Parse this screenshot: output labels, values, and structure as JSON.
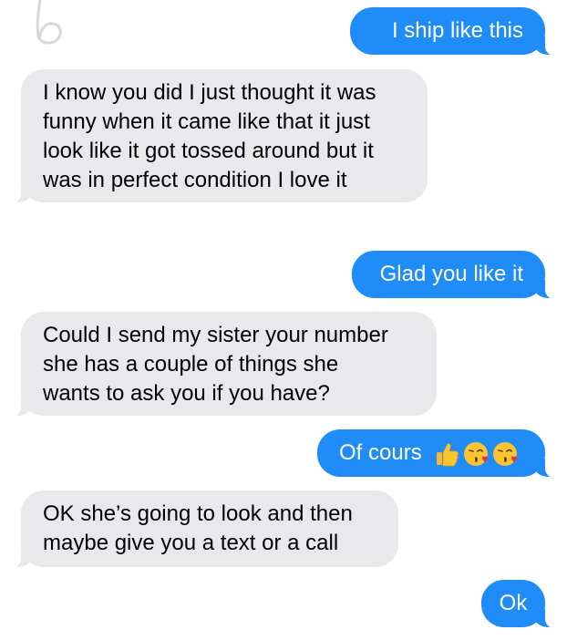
{
  "messages": [
    {
      "id": "m1",
      "direction": "sent",
      "text": "I ship like this"
    },
    {
      "id": "m2",
      "direction": "received",
      "lines": [
        "I know you did I just thought it was",
        "funny when it came like that it just",
        "look like it got tossed around but it",
        "was in perfect condition I love it"
      ]
    },
    {
      "id": "m3",
      "direction": "sent",
      "text": "Glad you like it"
    },
    {
      "id": "m4",
      "direction": "received",
      "lines": [
        "Could I send my sister your number",
        "she has a couple of things she",
        "wants to ask you if you have?"
      ]
    },
    {
      "id": "m5",
      "direction": "sent",
      "text": "Of cours",
      "emojis": [
        "thumbs-up-icon",
        "kissing-face-icon",
        "kissing-face-icon"
      ]
    },
    {
      "id": "m6",
      "direction": "received",
      "lines": [
        "OK she’s going to look and then",
        "maybe give you a text or a call"
      ]
    },
    {
      "id": "m7",
      "direction": "sent",
      "text": "Ok"
    }
  ],
  "colors": {
    "sent_bubble": "#1f8cf8",
    "received_bubble": "#e9e9eb",
    "sent_text": "#ffffff",
    "received_text": "#000000"
  }
}
